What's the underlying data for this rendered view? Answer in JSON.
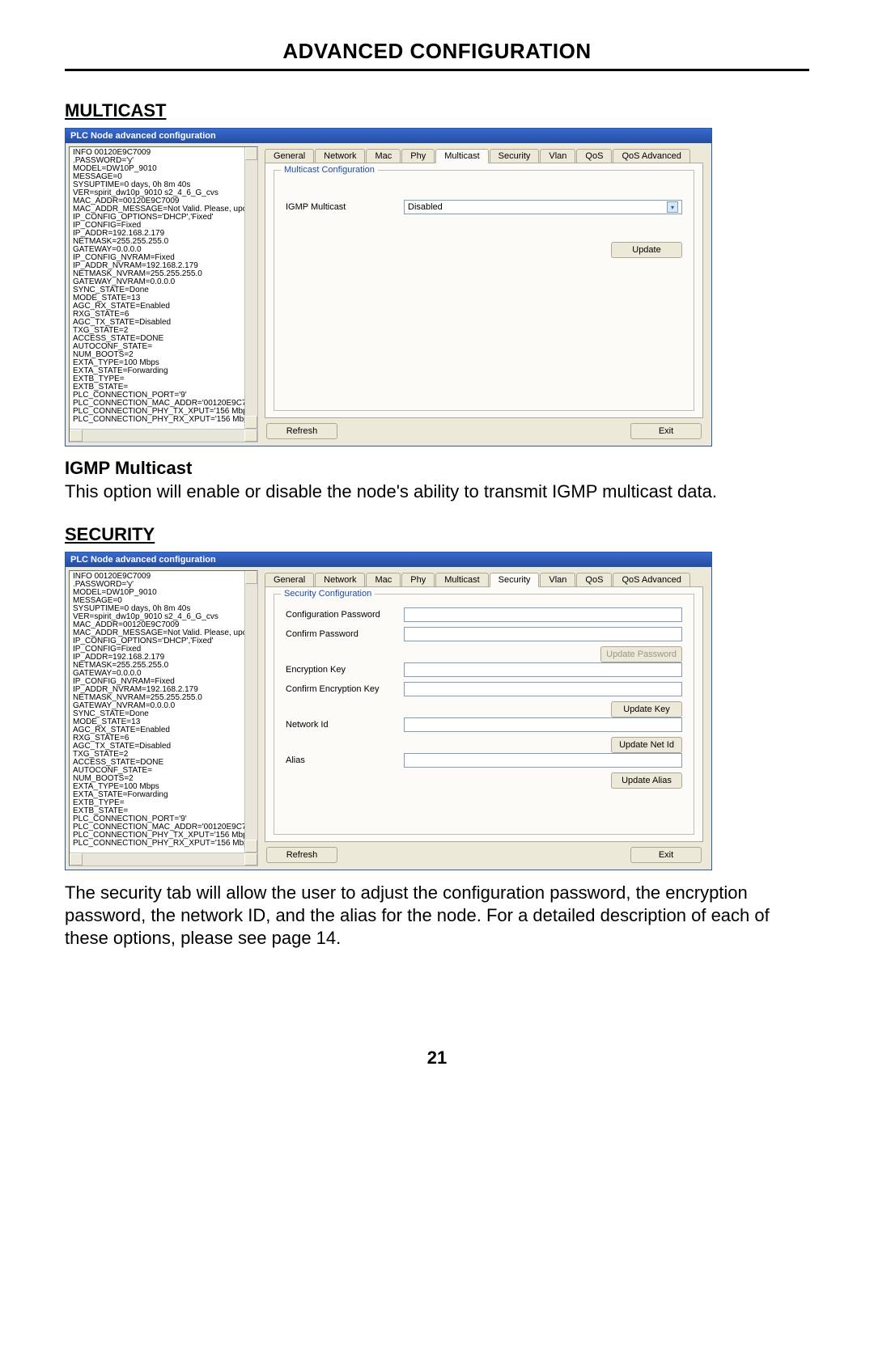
{
  "page": {
    "title": "ADVANCED CONFIGURATION",
    "number": "21"
  },
  "sections": {
    "multicast_heading": "MULTICAST",
    "igmp_heading": "IGMP Multicast",
    "igmp_text": "This option will enable or disable the node's ability to transmit IGMP multicast data.",
    "security_heading": "SECURITY",
    "security_text": "The security tab will allow the user to adjust the configuration password, the encryption password, the network ID, and the alias for the node. For a detailed description of each of these options, please see page 14."
  },
  "dialog": {
    "title": "PLC Node advanced configuration",
    "tabs": [
      "General",
      "Network",
      "Mac",
      "Phy",
      "Multicast",
      "Security",
      "Vlan",
      "QoS",
      "QoS Advanced"
    ],
    "info_lines": [
      "INFO 00120E9C7009",
      ".PASSWORD='y'",
      "MODEL=DW10P_9010",
      "MESSAGE=0",
      "SYSUPTIME=0 days, 0h 8m 40s",
      "VER=spirit_dw10p_9010 s2_4_6_G_cvs",
      "MAC_ADDR=00120E9C7009",
      "MAC_ADDR_MESSAGE=Not Valid. Please, upc",
      "IP_CONFIG_OPTIONS='DHCP','Fixed'",
      "IP_CONFIG=Fixed",
      "IP_ADDR=192.168.2.179",
      "NETMASK=255.255.255.0",
      "GATEWAY=0.0.0.0",
      "IP_CONFIG_NVRAM=Fixed",
      "IP_ADDR_NVRAM=192.168.2.179",
      "NETMASK_NVRAM=255.255.255.0",
      "GATEWAY_NVRAM=0.0.0.0",
      "SYNC_STATE=Done",
      "MODE_STATE=13",
      "AGC_RX_STATE=Enabled",
      "RXG_STATE=6",
      "AGC_TX_STATE=Disabled",
      "TXG_STATE=2",
      "ACCESS_STATE=DONE",
      "AUTOCONF_STATE=",
      "NUM_BOOTS=2",
      "EXTA_TYPE=100 Mbps",
      "EXTA_STATE=Forwarding",
      "EXTB_TYPE=",
      "EXTB_STATE=",
      "PLC_CONNECTION_PORT='9'",
      "PLC_CONNECTION_MAC_ADDR='00120E9C7",
      "PLC_CONNECTION_PHY_TX_XPUT='156 Mbp",
      "PLC_CONNECTION_PHY_RX_XPUT='156 Mbp"
    ],
    "multicast_panel": {
      "legend": "Multicast Configuration",
      "igmp_label": "IGMP Multicast",
      "igmp_value": "Disabled",
      "update_btn": "Update"
    },
    "security_panel": {
      "legend": "Security Configuration",
      "conf_pw_label": "Configuration Password",
      "confirm_pw_label": "Confirm Password",
      "update_pw_btn": "Update Password",
      "enc_key_label": "Encryption Key",
      "confirm_enc_label": "Confirm Encryption Key",
      "update_key_btn": "Update Key",
      "netid_label": "Network Id",
      "update_netid_btn": "Update Net Id",
      "alias_label": "Alias",
      "update_alias_btn": "Update Alias"
    },
    "refresh_btn": "Refresh",
    "exit_btn": "Exit"
  }
}
